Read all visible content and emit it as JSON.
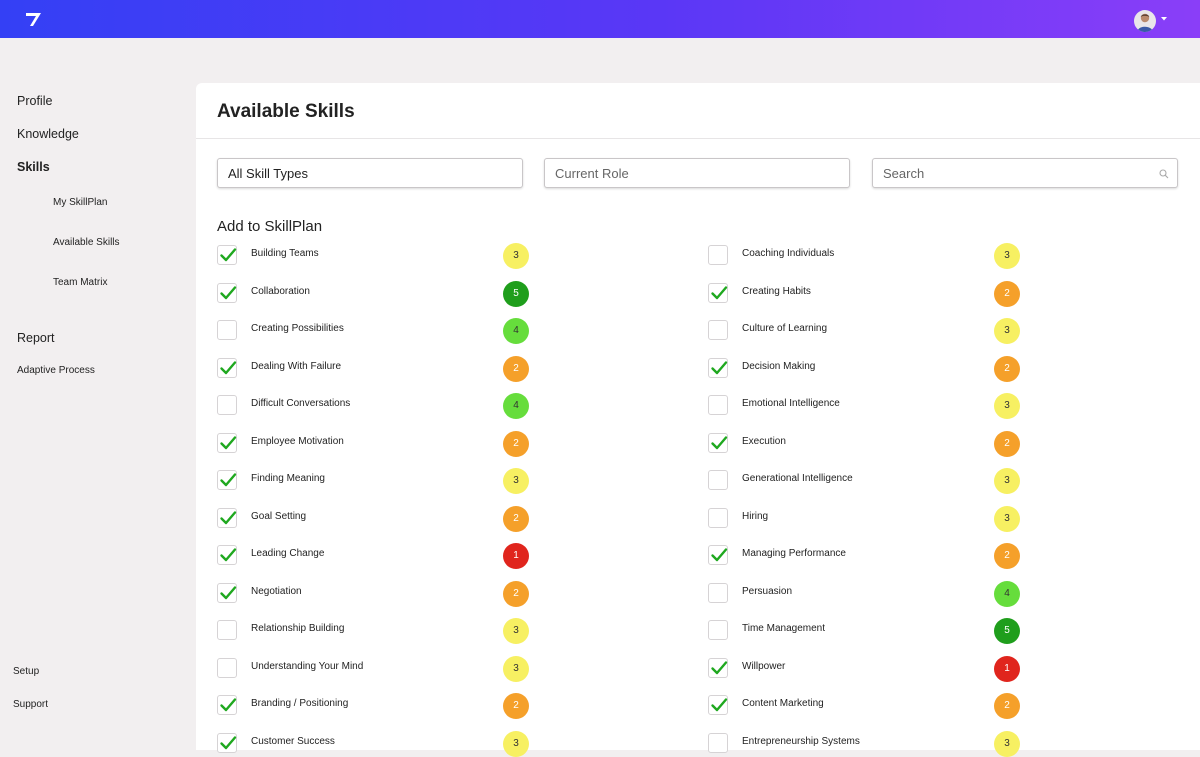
{
  "colors": {
    "level_1": "#e0251d",
    "level_2": "#f5a02a",
    "level_3": "#f7f062",
    "level_4": "#66dd3c",
    "level_5": "#1f9e1c",
    "check": "#1fa81f"
  },
  "icons": {
    "logo": "brand-7-logo",
    "avatar": "user-avatar",
    "caret": "caret-down",
    "search": "search-icon",
    "check": "check-icon"
  },
  "sidebar": {
    "items": [
      {
        "label": "Profile"
      },
      {
        "label": "Knowledge"
      },
      {
        "label": "Skills",
        "active": true
      }
    ],
    "sub_items": [
      {
        "label": "My SkillPlan"
      },
      {
        "label": "Available Skills"
      },
      {
        "label": "Team Matrix"
      }
    ],
    "report": "Report",
    "adaptive": "Adaptive Process",
    "setup": "Setup",
    "support": "Support"
  },
  "main": {
    "title": "Available Skills",
    "filters": {
      "skill_type": "All Skill Types",
      "role_placeholder": "Current Role",
      "search_placeholder": "Search"
    },
    "section_title": "Add to SkillPlan",
    "left_skills": [
      {
        "name": "Building Teams",
        "checked": true,
        "level": 3
      },
      {
        "name": "Collaboration",
        "checked": true,
        "level": 5
      },
      {
        "name": "Creating Possibilities",
        "checked": false,
        "level": 4
      },
      {
        "name": "Dealing With Failure",
        "checked": true,
        "level": 2
      },
      {
        "name": "Difficult Conversations",
        "checked": false,
        "level": 4
      },
      {
        "name": "Employee Motivation",
        "checked": true,
        "level": 2
      },
      {
        "name": "Finding Meaning",
        "checked": true,
        "level": 3
      },
      {
        "name": "Goal Setting",
        "checked": true,
        "level": 2
      },
      {
        "name": "Leading Change",
        "checked": true,
        "level": 1
      },
      {
        "name": "Negotiation",
        "checked": true,
        "level": 2
      },
      {
        "name": "Relationship Building",
        "checked": false,
        "level": 3
      },
      {
        "name": "Understanding Your Mind",
        "checked": false,
        "level": 3
      },
      {
        "name": "Branding / Positioning",
        "checked": true,
        "level": 2
      },
      {
        "name": "Customer Success",
        "checked": true,
        "level": 3
      }
    ],
    "right_skills": [
      {
        "name": "Coaching Individuals",
        "checked": false,
        "level": 3
      },
      {
        "name": "Creating Habits",
        "checked": true,
        "level": 2
      },
      {
        "name": "Culture of Learning",
        "checked": false,
        "level": 3
      },
      {
        "name": "Decision Making",
        "checked": true,
        "level": 2
      },
      {
        "name": "Emotional Intelligence",
        "checked": false,
        "level": 3
      },
      {
        "name": "Execution",
        "checked": true,
        "level": 2
      },
      {
        "name": "Generational Intelligence",
        "checked": false,
        "level": 3
      },
      {
        "name": "Hiring",
        "checked": false,
        "level": 3
      },
      {
        "name": "Managing Performance",
        "checked": true,
        "level": 2
      },
      {
        "name": "Persuasion",
        "checked": false,
        "level": 4
      },
      {
        "name": "Time Management",
        "checked": false,
        "level": 5
      },
      {
        "name": "Willpower",
        "checked": true,
        "level": 1
      },
      {
        "name": "Content Marketing",
        "checked": true,
        "level": 2
      },
      {
        "name": "Entrepreneurship Systems",
        "checked": false,
        "level": 3
      }
    ]
  }
}
